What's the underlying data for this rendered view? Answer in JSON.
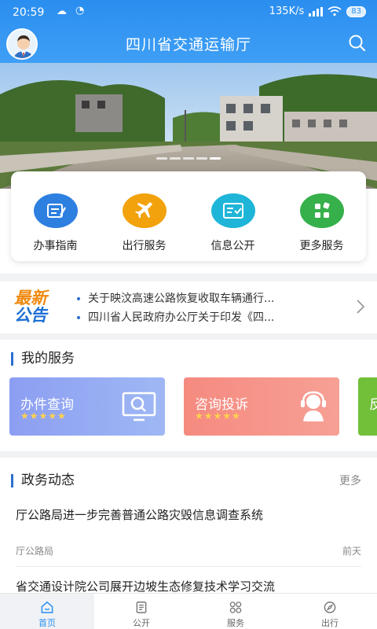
{
  "status_bar": {
    "time": "20:59",
    "network_speed": "135K/s",
    "battery": "83"
  },
  "header": {
    "title": "四川省交通运输厅"
  },
  "banner": {
    "slide_count": 5,
    "active_slide": 5
  },
  "quick_services": [
    {
      "label": "办事指南",
      "icon": "guide-icon",
      "color": "#2d7fe0"
    },
    {
      "label": "出行服务",
      "icon": "airplane-icon",
      "color": "#f2a20c"
    },
    {
      "label": "信息公开",
      "icon": "info-card-icon",
      "color": "#1fb5d8"
    },
    {
      "label": "更多服务",
      "icon": "grid-icon",
      "color": "#36b04a"
    }
  ],
  "notice": {
    "logo_lines": [
      "最新",
      "公告"
    ],
    "items": [
      "关于映汶高速公路恢复收取车辆通行...",
      "四川省人民政府办公厅关于印发《四..."
    ]
  },
  "my_services": {
    "title": "我的服务",
    "tiles": [
      {
        "label": "办件查询",
        "stars": "★★★★★",
        "icon": "monitor-search-icon",
        "color": "#8fa6f3"
      },
      {
        "label": "咨询投诉",
        "stars": "★★★★★",
        "icon": "headset-icon",
        "color": "#f78f86"
      },
      {
        "label": "反",
        "color": "#72c03a"
      }
    ]
  },
  "news": {
    "title": "政务动态",
    "more": "更多",
    "items": [
      {
        "title": "厅公路局进一步完善普通公路灾毁信息调查系统",
        "source": "厅公路局",
        "time": "前天"
      },
      {
        "title": "省交通设计院公司展开边坡生态修复技术学习交流"
      }
    ]
  },
  "bottom_nav": [
    {
      "label": "首页",
      "icon": "home-icon",
      "active": true
    },
    {
      "label": "公开",
      "icon": "document-icon",
      "active": false
    },
    {
      "label": "服务",
      "icon": "grid-icon",
      "active": false
    },
    {
      "label": "出行",
      "icon": "compass-icon",
      "active": false
    }
  ]
}
